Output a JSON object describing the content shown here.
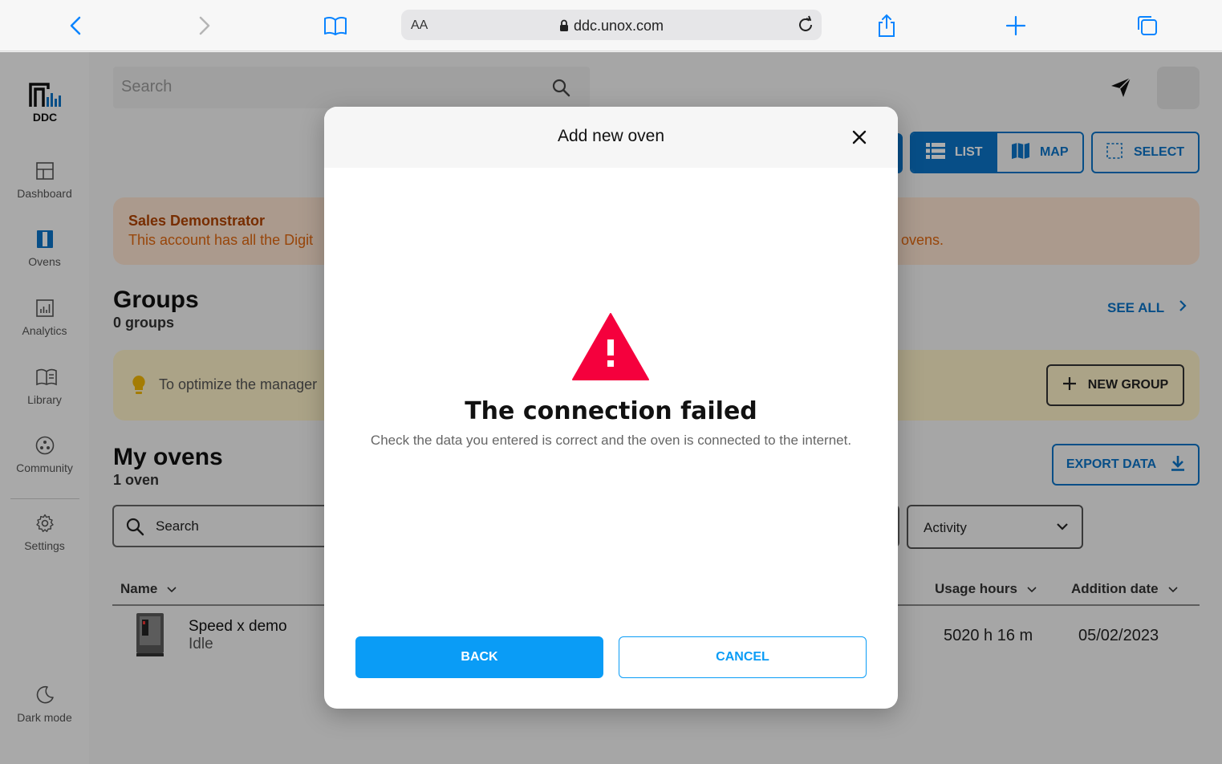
{
  "browser": {
    "text_size_label": "AA",
    "url": "ddc.unox.com"
  },
  "sidebar": {
    "logo_text": "DDC",
    "items": [
      {
        "label": "Dashboard",
        "icon": "dashboard-icon"
      },
      {
        "label": "Ovens",
        "icon": "oven-icon"
      },
      {
        "label": "Analytics",
        "icon": "analytics-icon"
      },
      {
        "label": "Library",
        "icon": "library-icon"
      },
      {
        "label": "Community",
        "icon": "community-icon"
      },
      {
        "label": "Settings",
        "icon": "gear-icon"
      }
    ],
    "dark_mode_label": "Dark mode"
  },
  "header": {
    "search_placeholder": "Search"
  },
  "view_toggle": {
    "list_label": "LIST",
    "map_label": "MAP",
    "select_label": "SELECT"
  },
  "sales_banner": {
    "title": "Sales Demonstrator",
    "text": "This account has all the Digit",
    "tail": "ovens."
  },
  "groups": {
    "title": "Groups",
    "count": "0 groups",
    "see_all": "SEE ALL",
    "tip_text": "To optimize the manager",
    "new_group": "NEW GROUP"
  },
  "my_ovens": {
    "title": "My ovens",
    "count": "1 oven",
    "export_label": "EXPORT DATA",
    "search_placeholder": "Search",
    "activity_filter": "Activity",
    "columns": {
      "name": "Name",
      "usage_hours": "Usage hours",
      "addition_date": "Addition date"
    },
    "rows": [
      {
        "name": "Speed x demo",
        "status": "Idle",
        "usage_hours": "5020 h 16 m",
        "addition_date": "05/02/2023"
      }
    ]
  },
  "modal": {
    "title": "Add new oven",
    "error_title": "The connection failed",
    "error_message": "Check the data you entered is correct and the oven is connected to the internet.",
    "back_label": "BACK",
    "cancel_label": "CANCEL"
  },
  "colors": {
    "primary": "#0b73c7",
    "modal_button": "#0a9cf6",
    "warning_red": "#f5003d",
    "sales_banner_bg": "#fde3d0",
    "tip_banner_bg": "#fdf1c8"
  }
}
